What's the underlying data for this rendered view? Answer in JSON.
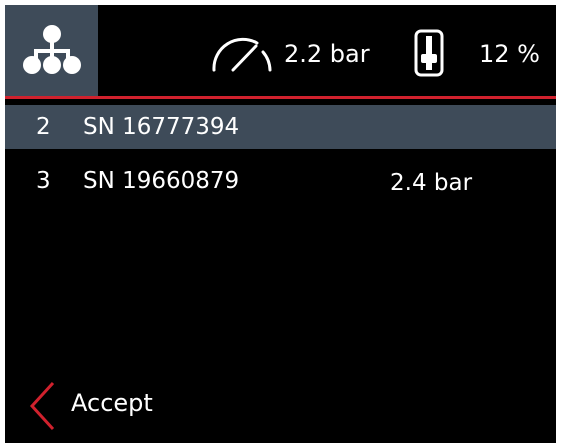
{
  "header": {
    "menu_icon": "network-nodes-icon",
    "pressure": {
      "icon": "pressure-gauge-icon",
      "value": "2.2 bar"
    },
    "level": {
      "icon": "level-indicator-icon",
      "value": "12 %"
    }
  },
  "devices": [
    {
      "index": "2",
      "serial": "SN 16777394",
      "reading": "",
      "selected": true
    },
    {
      "index": "3",
      "serial": "SN 19660879",
      "reading": "2.4 bar",
      "selected": false
    }
  ],
  "footer": {
    "back_icon": "chevron-left-icon",
    "accept_label": "Accept"
  },
  "colors": {
    "background": "#000000",
    "selected_row": "#3e4b59",
    "accent_red": "#d0212d",
    "text": "#ffffff"
  }
}
